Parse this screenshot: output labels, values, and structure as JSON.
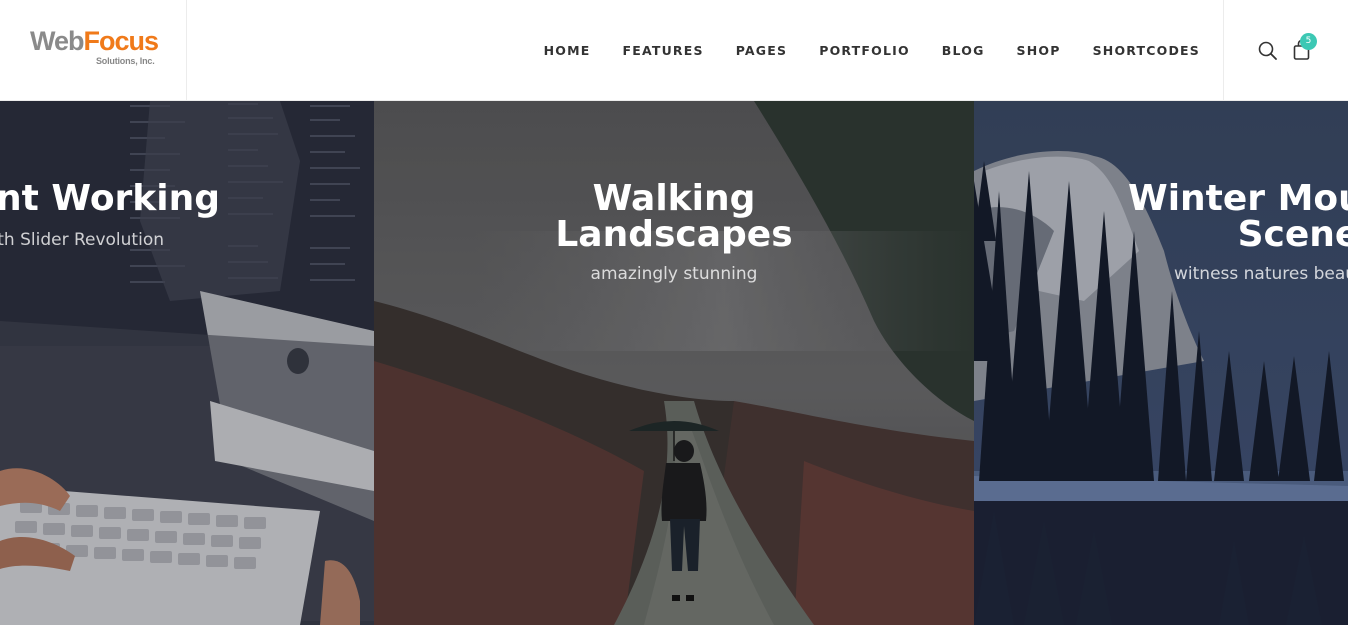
{
  "brand": {
    "name_part1": "Web",
    "name_part2": "Focus",
    "tagline": "Solutions, Inc."
  },
  "nav": {
    "items": [
      "HOME",
      "FEATURES",
      "PAGES",
      "PORTFOLIO",
      "BLOG",
      "SHOP",
      "SHORTCODES"
    ]
  },
  "tools": {
    "cart_count": "5"
  },
  "slides": [
    {
      "title_line1": "Efficient Working",
      "subtitle": "With Slider Revolution"
    },
    {
      "title_line1": "Walking",
      "title_line2": "Landscapes",
      "subtitle": "amazingly stunning"
    },
    {
      "title_line1": "Winter Mountain",
      "title_line2": "Scene",
      "subtitle": "witness natures beauty"
    }
  ],
  "colors": {
    "accent": "#3cc8b4",
    "logo_orange": "#f07a1a",
    "logo_gray": "#8a8a8a"
  }
}
